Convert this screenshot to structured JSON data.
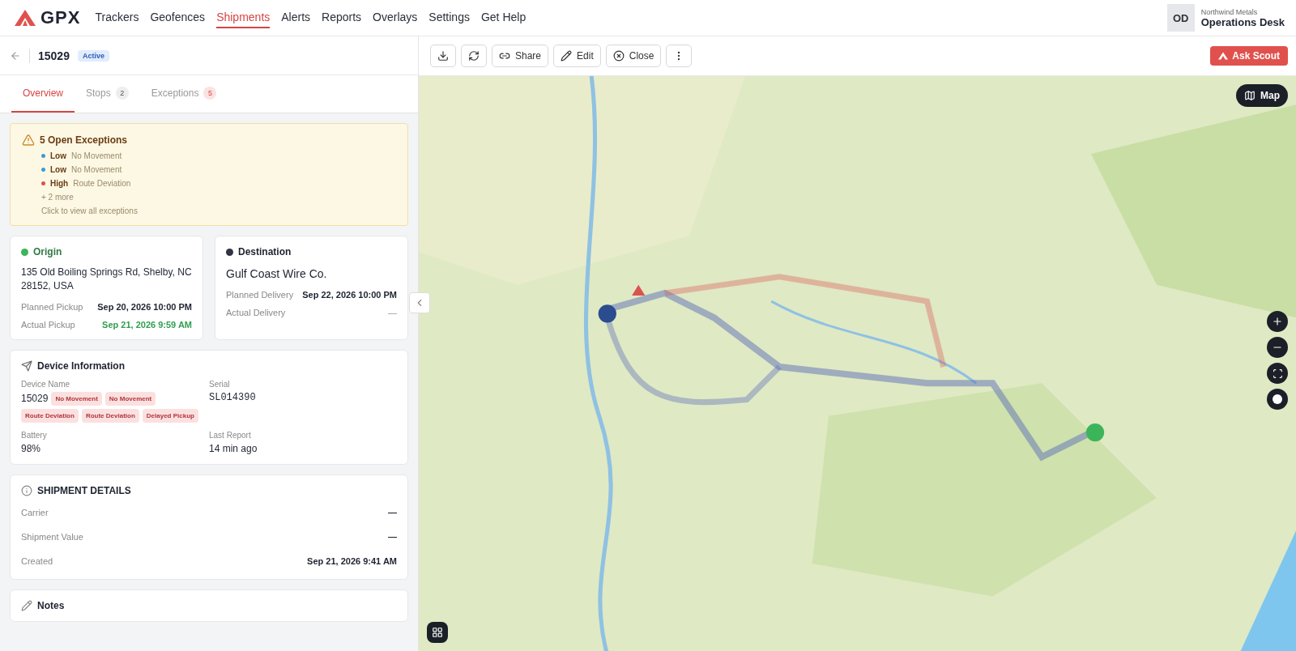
{
  "nav": {
    "logo": "GPX",
    "items": [
      {
        "label": "Trackers",
        "selected": false
      },
      {
        "label": "Geofences",
        "selected": false
      },
      {
        "label": "Shipments",
        "selected": true
      },
      {
        "label": "Alerts",
        "selected": false
      },
      {
        "label": "Reports",
        "selected": false
      },
      {
        "label": "Overlays",
        "selected": false
      },
      {
        "label": "Settings",
        "selected": false
      },
      {
        "label": "Get Help",
        "selected": false
      }
    ],
    "account": {
      "initials": "OD",
      "org": "Northwind Metals",
      "name": "Operations Desk"
    }
  },
  "shipment": {
    "id": "15029",
    "status": "Active"
  },
  "tabs": [
    {
      "label": "Overview",
      "selected": true
    },
    {
      "label": "Stops",
      "count": "2",
      "selected": false
    },
    {
      "label": "Exceptions",
      "count": "5",
      "selected": false
    }
  ],
  "exceptions": {
    "title": "5 Open Exceptions",
    "items": [
      {
        "level": "Low",
        "text": "No Movement",
        "color": "#3b9ad9"
      },
      {
        "level": "Low",
        "text": "No Movement",
        "color": "#3b9ad9"
      },
      {
        "level": "High",
        "text": "Route Deviation",
        "color": "#d9534f"
      }
    ],
    "more": "+ 2 more",
    "hint": "Click to view all exceptions"
  },
  "stops": [
    {
      "title": "Origin",
      "color": "#3cb55a",
      "place": "135 Old Boiling Springs Rd, Shelby, NC 28152, USA",
      "rows": [
        {
          "label": "Planned Pickup",
          "value": "Sep 20, 2026 10:00 PM",
          "kind": "plain"
        },
        {
          "label": "Actual Pickup",
          "value": "Sep 21, 2026 9:59 AM",
          "kind": "success"
        }
      ]
    },
    {
      "title": "Destination",
      "color": "#2f3542",
      "place": "Gulf Coast Wire Co.",
      "rows": [
        {
          "label": "Planned Delivery",
          "value": "Sep 22, 2026 10:00 PM",
          "kind": "plain"
        },
        {
          "label": "Actual Delivery",
          "value": "—",
          "kind": "muted"
        }
      ]
    }
  ],
  "device": {
    "title": "Device Information",
    "name_label": "Device Name",
    "name": "15029",
    "tags": [
      "No Movement",
      "No Movement",
      "Route Deviation",
      "Route Deviation",
      "Delayed Pickup"
    ],
    "serial_label": "Serial",
    "serial": "SL014390",
    "battery_label": "Battery",
    "battery": "98%",
    "report_label": "Last Report",
    "report": "14 min ago"
  },
  "details": {
    "title": "SHIPMENT DETAILS",
    "rows": [
      {
        "label": "Carrier",
        "value": "—"
      },
      {
        "label": "Shipment Value",
        "value": "—"
      },
      {
        "label": "Created",
        "value": "Sep 21, 2026 9:41 AM"
      }
    ]
  },
  "notes": {
    "title": "Notes"
  },
  "toolbar": {
    "buttons": [
      {
        "kind": "download"
      },
      {
        "kind": "refresh"
      },
      {
        "kind": "share",
        "label": "Share"
      },
      {
        "kind": "edit",
        "label": "Edit"
      },
      {
        "kind": "close",
        "label": "Close"
      },
      {
        "kind": "more"
      }
    ],
    "ask": "Ask Scout"
  },
  "map": {
    "kind": "picture",
    "layer_button": "Map"
  }
}
